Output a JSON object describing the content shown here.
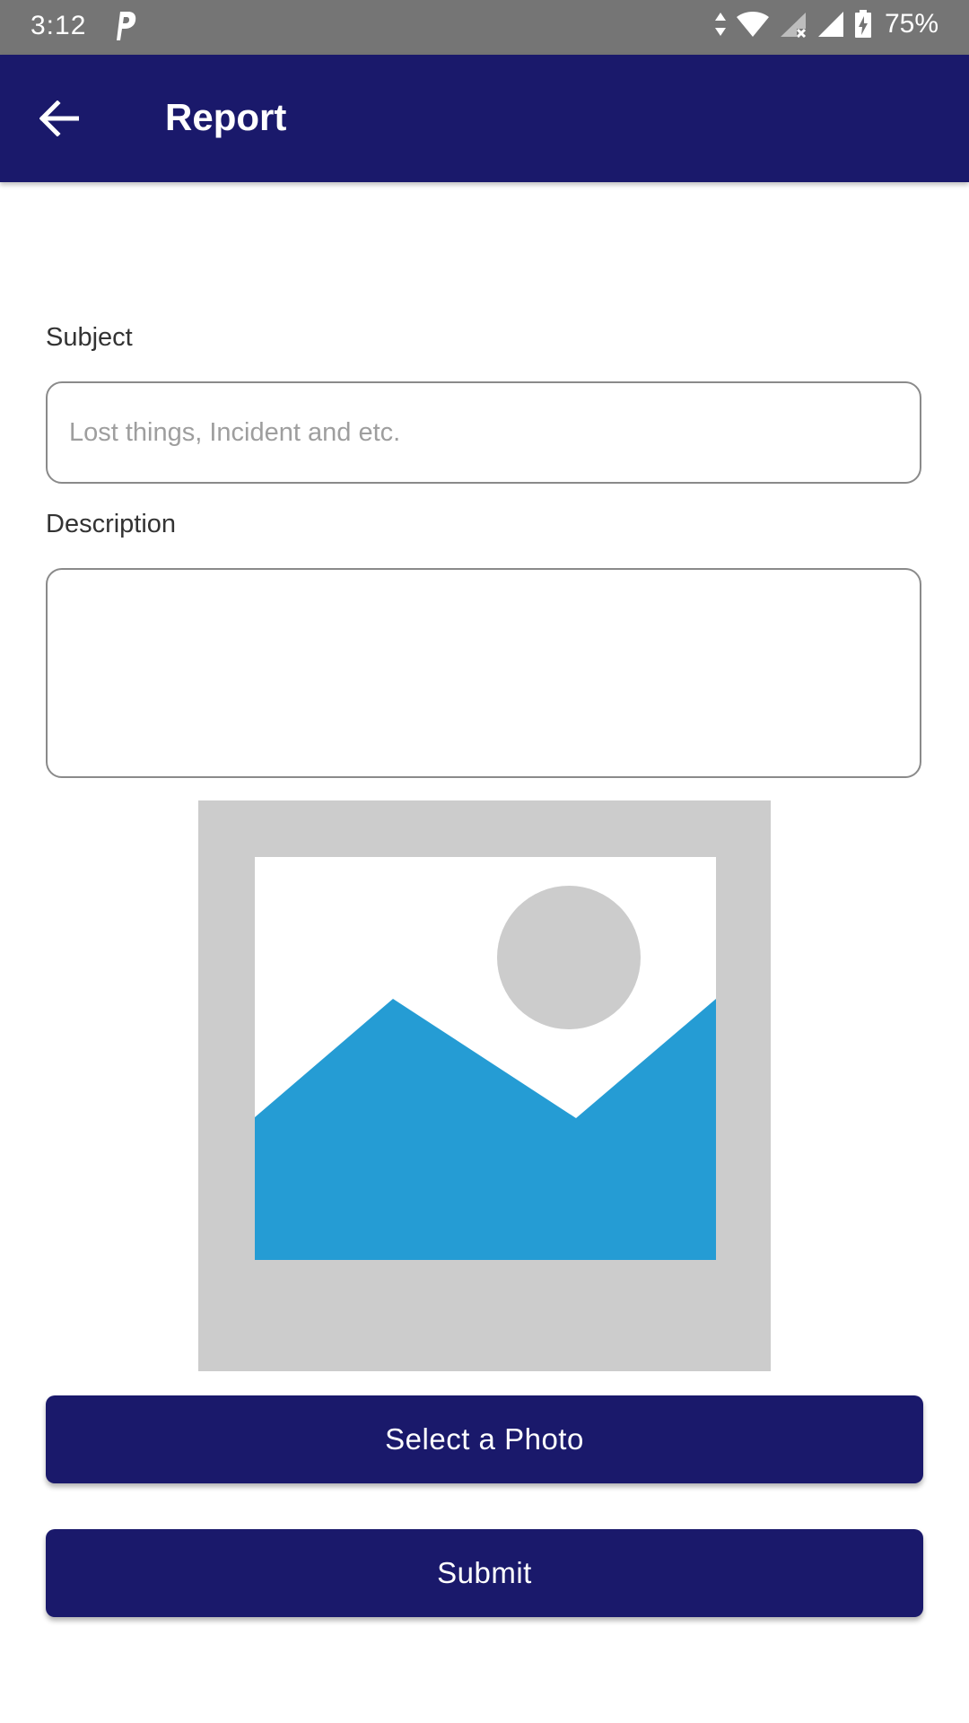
{
  "status_bar": {
    "time": "3:12",
    "battery_percent": "75%",
    "icons": [
      "parking-icon",
      "data-arrows-icon",
      "wifi-icon",
      "signal-x-icon",
      "signal-icon",
      "battery-charging-icon"
    ]
  },
  "app_bar": {
    "title": "Report",
    "back_icon": "arrow-back-icon"
  },
  "form": {
    "subject_label": "Subject",
    "subject_value": "",
    "subject_placeholder": "Lost things, Incident and etc.",
    "description_label": "Description",
    "description_value": "",
    "description_placeholder": "",
    "photo_placeholder_icon": "image-placeholder-icon"
  },
  "buttons": {
    "select_photo": "Select a Photo",
    "submit": "Submit"
  },
  "colors": {
    "primary": "#1a196b",
    "status_bar": "#757575",
    "placeholder_bg": "#cccccc",
    "image_mountain": "#259cd4"
  }
}
